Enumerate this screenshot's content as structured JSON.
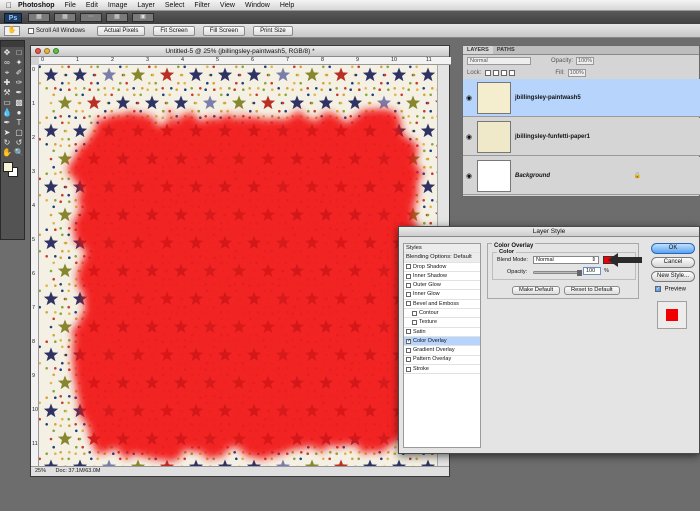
{
  "menubar": {
    "app": "Photoshop",
    "items": [
      "File",
      "Edit",
      "Image",
      "Layer",
      "Select",
      "Filter",
      "View",
      "Window",
      "Help"
    ]
  },
  "appbar": {
    "badge": "Ps"
  },
  "options": {
    "scroll_all": "Scroll All Windows",
    "buttons": [
      "Actual Pixels",
      "Fit Screen",
      "Fill Screen",
      "Print Size"
    ]
  },
  "document": {
    "title": "Untitled-5 @ 25% (jbillingsley-paintwash5, RGB/8) *",
    "zoom": "25%",
    "doc_size": "Doc: 37.1M/63.0M",
    "ruler_top": [
      "0",
      "1",
      "2",
      "3",
      "4",
      "5",
      "6",
      "7",
      "8",
      "9",
      "10",
      "11"
    ],
    "ruler_left": [
      "0",
      "1",
      "2",
      "3",
      "4",
      "5",
      "6",
      "7",
      "8",
      "9",
      "10",
      "11"
    ]
  },
  "layers_panel": {
    "tabs": [
      "LAYERS",
      "PATHS"
    ],
    "blend_mode": "Normal",
    "opacity_label": "Opacity:",
    "opacity": "100%",
    "lock_label": "Lock:",
    "fill_label": "Fill:",
    "fill": "100%",
    "layers": [
      {
        "name": "jbillingsley-paintwash5",
        "selected": true
      },
      {
        "name": "jbillingsley-funfetti-paper1",
        "selected": false
      },
      {
        "name": "Background",
        "selected": false
      }
    ]
  },
  "dialog": {
    "title": "Layer Style",
    "styles_header": "Styles",
    "styles": [
      {
        "label": "Blending Options: Default",
        "check": false,
        "head": true
      },
      {
        "label": "Drop Shadow",
        "check": true,
        "checked": false
      },
      {
        "label": "Inner Shadow",
        "check": true,
        "checked": false
      },
      {
        "label": "Outer Glow",
        "check": true,
        "checked": false
      },
      {
        "label": "Inner Glow",
        "check": true,
        "checked": false
      },
      {
        "label": "Bevel and Emboss",
        "check": true,
        "checked": false
      },
      {
        "label": "Contour",
        "check": true,
        "checked": false,
        "indent": true
      },
      {
        "label": "Texture",
        "check": true,
        "checked": false,
        "indent": true
      },
      {
        "label": "Satin",
        "check": true,
        "checked": false
      },
      {
        "label": "Color Overlay",
        "check": true,
        "checked": true,
        "selected": true
      },
      {
        "label": "Gradient Overlay",
        "check": true,
        "checked": false
      },
      {
        "label": "Pattern Overlay",
        "check": true,
        "checked": false
      },
      {
        "label": "Stroke",
        "check": true,
        "checked": false
      }
    ],
    "group_title": "Color Overlay",
    "inner_title": "Color",
    "blend_mode_label": "Blend Mode:",
    "blend_mode": "Normal",
    "opacity_label": "Opacity:",
    "opacity": "100",
    "opacity_unit": "%",
    "overlay_color": "#f00000",
    "make_default": "Make Default",
    "reset_default": "Reset to Default",
    "ok": "OK",
    "cancel": "Cancel",
    "new_style": "New Style...",
    "preview": "Preview"
  },
  "colors": {
    "paint_red": "#f21a1a",
    "accent": "#5aa3f2",
    "layer_selected": "#b6d4fc"
  }
}
